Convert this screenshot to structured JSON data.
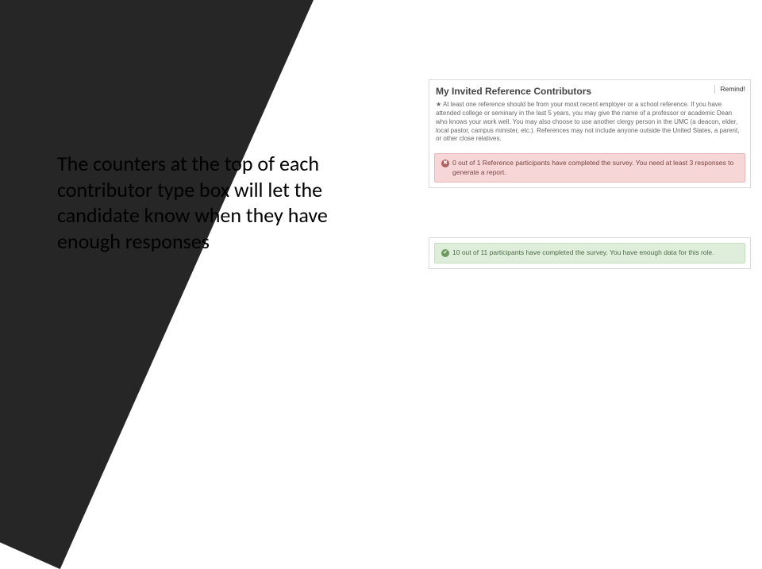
{
  "slide": {
    "caption": "The counters at the top of each contributor type box will let the candidate know when they have enough responses"
  },
  "panel": {
    "title": "My Invited Reference Contributors",
    "remind_label": "Remind!",
    "description_lead": "★",
    "description": "At least one reference should be from your most recent employer or a school reference. If you have attended college or seminary in the last 5 years, you may give the name of a professor or academic Dean who knows your work well. You may also choose to use another clergy person in the UMC (a deacon, elder, local pastor, campus minister, etc.). References may not include anyone outside the United States, a parent, or other close relatives.",
    "danger_icon": "✖",
    "danger_text": "0 out of 1 Reference participants have completed the survey. You need at least 3 responses to generate a report.",
    "success_icon": "✔",
    "success_text": "10 out of 11 participants have completed the survey. You have enough data for this role."
  }
}
